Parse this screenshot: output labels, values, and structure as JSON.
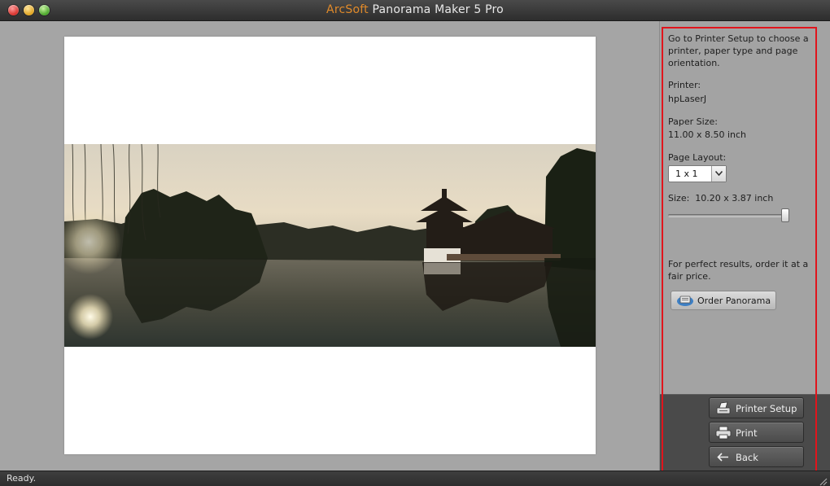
{
  "window": {
    "title_brand": "ArcSoft",
    "title_rest": " Panorama Maker 5 Pro"
  },
  "sidebar": {
    "intro": "Go to Printer Setup to choose a printer, paper type and page orientation.",
    "printer_label": "Printer:",
    "printer_value": "hpLaserJ",
    "paper_label": "Paper Size:",
    "paper_value": "11.00 x 8.50 inch",
    "layout_label": "Page Layout:",
    "layout_value": "1 x 1",
    "size_label": "Size:",
    "size_value": "10.20 x 3.87 inch",
    "size_slider_fraction": 0.97,
    "order_note": "For perfect results, order it at a fair price.",
    "order_button": "Order Panorama",
    "printer_setup_button": "Printer Setup",
    "print_button": "Print",
    "back_button": "Back"
  },
  "status": {
    "text": "Ready."
  },
  "colors": {
    "brand": "#e08a2a",
    "highlight": "#e1141c"
  }
}
